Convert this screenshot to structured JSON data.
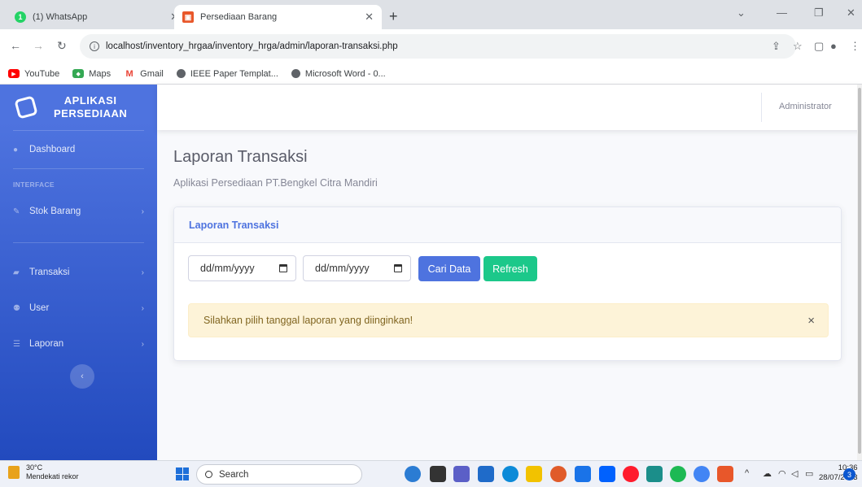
{
  "browser": {
    "tabs": [
      {
        "title": "(1) WhatsApp",
        "badge": "1"
      },
      {
        "title": "Persediaan Barang"
      }
    ],
    "new_tab": "+",
    "url": "localhost/inventory_hrgaa/inventory_hrga/admin/laporan-transaksi.php",
    "bookmarks": [
      "YouTube",
      "Maps",
      "Gmail",
      "IEEE Paper Templat...",
      "Microsoft Word - 0..."
    ]
  },
  "sidebar": {
    "brand_line1": "APLIKASI",
    "brand_line2": "PERSEDIAAN",
    "dashboard": "Dashboard",
    "heading": "INTERFACE",
    "items": [
      {
        "label": "Stok Barang",
        "icon": "wrench-icon"
      },
      {
        "label": "Transaksi",
        "icon": "truck-icon"
      },
      {
        "label": "User",
        "icon": "users-icon"
      },
      {
        "label": "Laporan",
        "icon": "list-icon"
      }
    ],
    "toggle_symbol": "‹"
  },
  "topbar": {
    "user": "Administrator"
  },
  "page": {
    "title": "Laporan Transaksi",
    "subtitle": "Aplikasi Persediaan PT.Bengkel Citra Mandiri"
  },
  "card": {
    "header": "Laporan Transaksi",
    "date_from_placeholder": "dd/mm/yyyy",
    "date_to_placeholder": "dd/mm/yyyy",
    "search_button": "Cari Data",
    "refresh_button": "Refresh",
    "alert_text": "Silahkan pilih tanggal laporan yang diinginkan!",
    "alert_close": "×"
  },
  "taskbar": {
    "weather_temp": "30°C",
    "weather_desc": "Mendekati rekor",
    "search": "Search",
    "time": "10:36",
    "date": "28/07/2023",
    "notification_count": "3"
  },
  "colors": {
    "primary": "#4e73df",
    "success": "#1cc88a",
    "alert_bg": "#fdf3d8"
  }
}
